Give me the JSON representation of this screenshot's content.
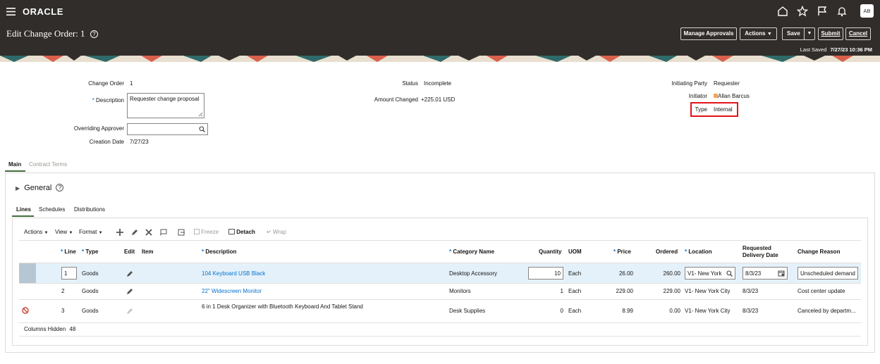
{
  "app": {
    "logo": "ORACLE",
    "user_initials": "AB"
  },
  "header": {
    "title": "Edit Change Order: 1",
    "buttons": {
      "manage_approvals": "Manage Approvals",
      "actions": "Actions",
      "save": "Save",
      "submit": "Submit",
      "cancel": "Cancel"
    },
    "last_saved_label": "Last Saved",
    "last_saved_value": "7/27/23 10:36 PM"
  },
  "form": {
    "change_order_label": "Change Order",
    "change_order_value": "1",
    "description_label": "Description",
    "description_value": "Requester change proposal",
    "overriding_approver_label": "Overriding Approver",
    "overriding_approver_value": "",
    "creation_date_label": "Creation Date",
    "creation_date_value": "7/27/23",
    "status_label": "Status",
    "status_value": "Incomplete",
    "amount_changed_label": "Amount Changed",
    "amount_changed_value": "+225.01 USD",
    "initiating_party_label": "Initiating Party",
    "initiating_party_value": "Requester",
    "initiator_label": "Initiator",
    "initiator_value": "Allan Barcus",
    "type_label": "Type",
    "type_value": "Internal"
  },
  "tabs": {
    "main": "Main",
    "contract_terms": "Contract Terms"
  },
  "general": {
    "title": "General"
  },
  "subtabs": {
    "lines": "Lines",
    "schedules": "Schedules",
    "distributions": "Distributions"
  },
  "toolbar": {
    "actions": "Actions",
    "view": "View",
    "format": "Format",
    "freeze": "Freeze",
    "detach": "Detach",
    "wrap": "Wrap"
  },
  "table": {
    "headers": {
      "line": "Line",
      "type": "Type",
      "edit": "Edit",
      "item": "Item",
      "description": "Description",
      "category": "Category Name",
      "quantity": "Quantity",
      "uom": "UOM",
      "price": "Price",
      "ordered": "Ordered",
      "location": "Location",
      "delivery_l1": "Requested",
      "delivery_l2": "Delivery Date",
      "reason": "Change Reason"
    },
    "rows": [
      {
        "line": "1",
        "type": "Goods",
        "description": "104 Keyboard USB Black",
        "category": "Desktop Accessory",
        "quantity": "10",
        "uom": "Each",
        "price": "26.00",
        "ordered": "260.00",
        "location": "V1- New York",
        "delivery": "8/3/23",
        "reason": "Unscheduled demand"
      },
      {
        "line": "2",
        "type": "Goods",
        "description": "22\" Widescreen Monitor",
        "category": "Monitors",
        "quantity": "1",
        "uom": "Each",
        "price": "229.00",
        "ordered": "229.00",
        "location": "V1- New York City",
        "delivery": "8/3/23",
        "reason": "Cost center update"
      },
      {
        "line": "3",
        "type": "Goods",
        "description": "6 in 1 Desk Organizer with Bluetooth Keyboard And Tablet Stand",
        "category": "Desk Supplies",
        "quantity": "0",
        "uom": "Each",
        "price": "8.99",
        "ordered": "0.00",
        "location": "V1- New York City",
        "delivery": "8/3/23",
        "reason": "Canceled by departm..."
      }
    ],
    "columns_hidden_label": "Columns Hidden",
    "columns_hidden_value": "48"
  }
}
